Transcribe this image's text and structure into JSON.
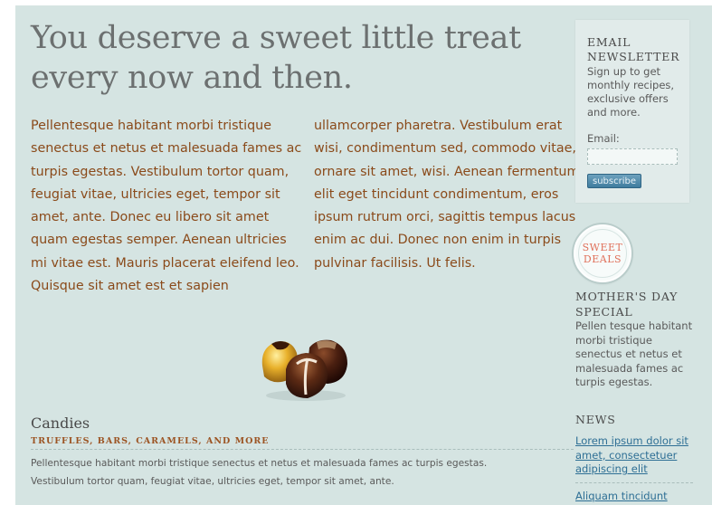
{
  "headline": "You deserve a sweet little treat every now and then.",
  "intro": {
    "column1": "Pellentesque habitant morbi tristique senectus et netus et malesuada fames ac turpis egestas. Vestibulum tortor quam, feugiat vitae, ultricies eget, tempor sit amet, ante. Donec eu libero sit amet quam egestas semper. Aenean ultricies mi vitae est. Mauris placerat eleifend leo. Quisque sit amet est et sapien",
    "column2": "ullamcorper pharetra. Vestibulum erat wisi, condimentum sed, commodo vitae, ornare sit amet, wisi. Aenean fermentum, elit eget tincidunt condimentum, eros ipsum rutrum orci, sagittis tempus lacus enim ac dui. Donec non enim in turpis pulvinar facilisis. Ut felis."
  },
  "newsletter": {
    "title": "EMAIL NEWSLETTER",
    "description": "Sign up to get monthly recipes, exclusive offers and more.",
    "email_label": "Email:",
    "email_value": "",
    "subscribe_label": "subscribe"
  },
  "badge": {
    "line1": "SWEET",
    "line2": "DEALS"
  },
  "special": {
    "title": "MOTHER'S DAY SPECIAL",
    "text": "Pellen tesque habitant morbi tristique senectus et netus et malesuada fames ac turpis egestas."
  },
  "news": {
    "title": "NEWS",
    "links": [
      "Lorem ipsum dolor sit amet, consectetuer adipiscing elit",
      "Aliquam tincidunt"
    ]
  },
  "candies": {
    "title": "Candies",
    "subtitle": "TRUFFLES, BARS, CARAMELS, AND MORE",
    "text": "Pellentesque habitant morbi tristique senectus et netus et malesuada fames ac turpis egestas. Vestibulum tortor quam, feugiat vitae, ultricies eget, tempor sit amet, ante."
  },
  "colors": {
    "background": "#d5e4e2",
    "body_text": "#8a4a1a",
    "link": "#2e6f95",
    "badge_text": "#e0705a"
  }
}
